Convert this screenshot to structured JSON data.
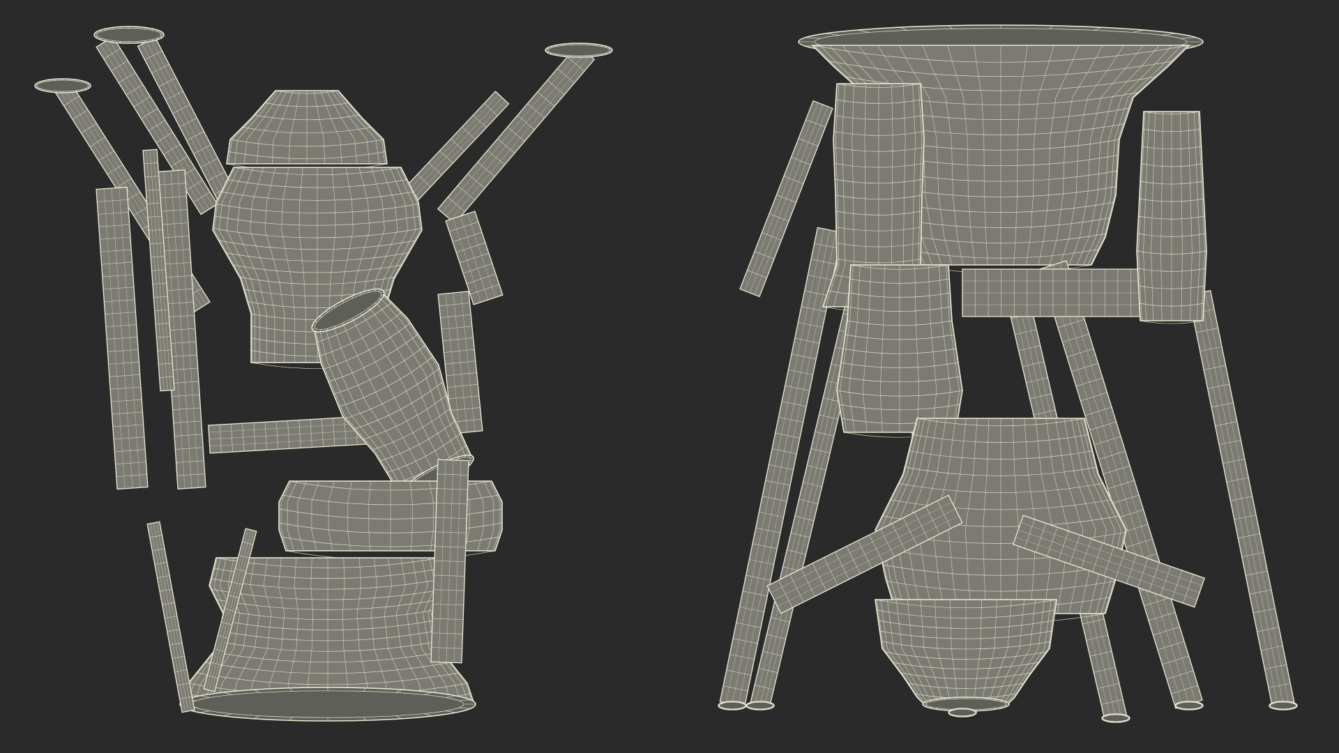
{
  "scene": {
    "background_color": "#2a2a2a",
    "surface_color": "#7b7b73",
    "surface_shade": "#5f5f59",
    "wire_color": "#ecead6",
    "views": []
  },
  "objects": [
    {
      "id": "engine-left",
      "kind": "rocket-engine-wireframe"
    },
    {
      "id": "engine-right",
      "kind": "rocket-engine-wireframe"
    }
  ]
}
